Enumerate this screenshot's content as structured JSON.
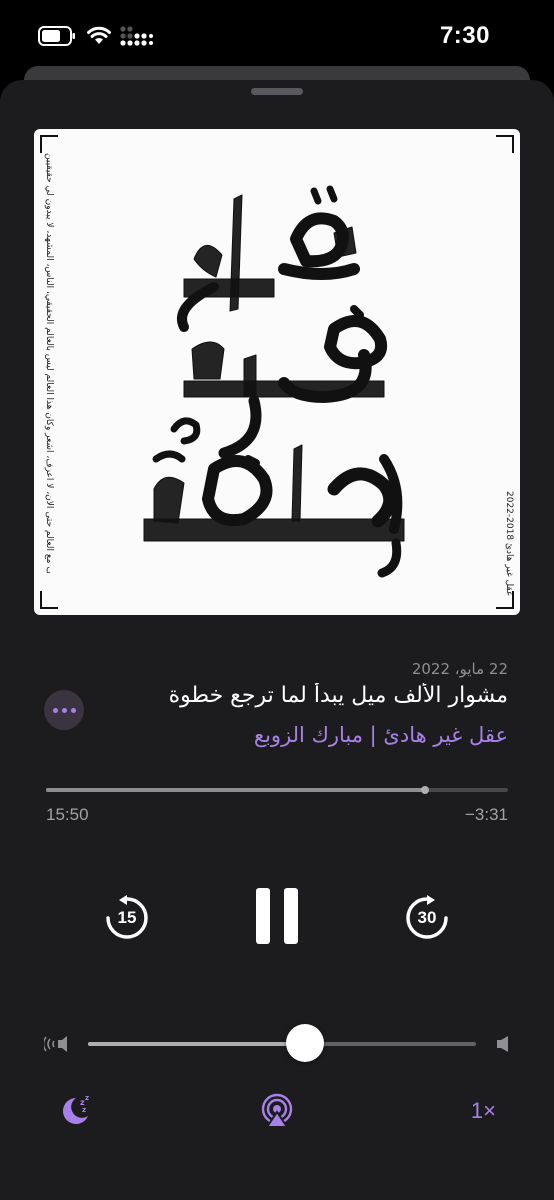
{
  "status_bar": {
    "time": "7:30",
    "icons": [
      "battery-icon",
      "wifi-icon",
      "cellular-icon"
    ]
  },
  "artwork": {
    "calligraphy_lines": [
      "عقل",
      "غير",
      "هادئ"
    ],
    "side_text_left": "ربما لم أتكيف مع العالم حتى الآن، لا أعرف، أشعر وكأن هذا العالم ليس بالعالم الحقيقي، الناس، المشهد، لا يبدون لي حقيقيين",
    "side_text_right": "عقل غير هادئ 2018-2022"
  },
  "episode": {
    "date": "22 مايو، 2022",
    "title": "مشوار الألف ميل يبدأ لما ترجع خطوة",
    "show": "عقل غير هادئ | مبارك الزوبع"
  },
  "playback": {
    "elapsed": "15:50",
    "remaining": "−3:31",
    "progress": 0.82,
    "skip_back_seconds": "15",
    "skip_forward_seconds": "30",
    "volume": 0.56,
    "speed": "1×"
  },
  "colors": {
    "accent": "#a881e8",
    "sheet": "#1c1c1e",
    "background": "#000000"
  },
  "icons": {
    "more": "more-icon",
    "skip_back": "skip-back-15-icon",
    "pause": "pause-icon",
    "skip_forward": "skip-forward-30-icon",
    "volume_low": "volume-low-icon",
    "volume_high": "volume-high-icon",
    "sleep": "sleep-timer-icon",
    "airplay": "airplay-icon"
  }
}
